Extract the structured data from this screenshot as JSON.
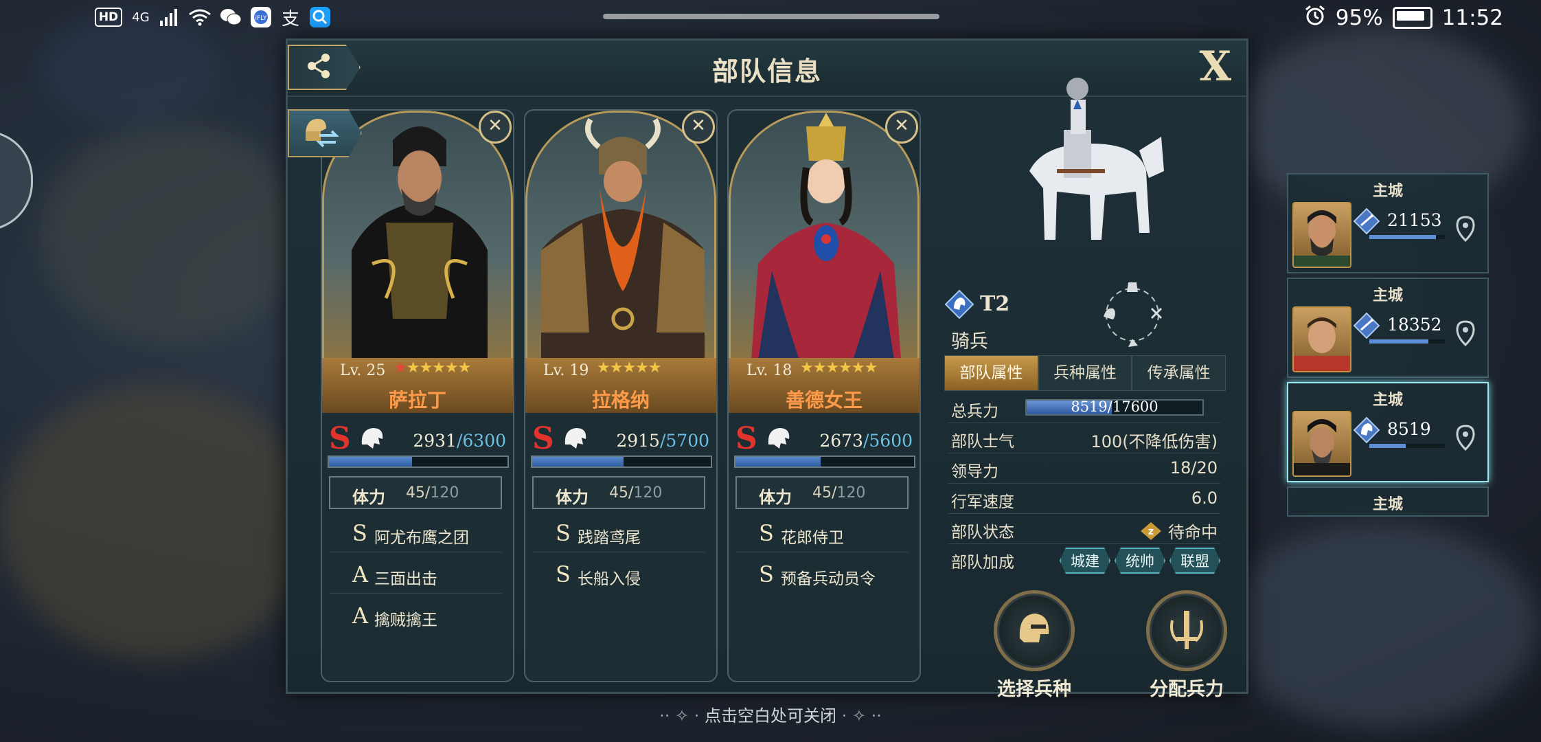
{
  "status_bar": {
    "left_icons": [
      "HD",
      "4G",
      "signal-icon",
      "wifi-icon",
      "wechat-icon",
      "ifly-icon",
      "alipay-icon",
      "search-app-icon"
    ],
    "alarm_icon": "alarm-icon",
    "battery_percent": "95%",
    "time": "11:52"
  },
  "panel": {
    "title": "部队信息",
    "close_label": "X",
    "share_icon": "share-icon",
    "swap_icon": "swap-commander-icon"
  },
  "commanders": [
    {
      "level": "Lv. 25",
      "stars": 6,
      "red_stars": 1,
      "name": "萨拉丁",
      "rank": "S",
      "troops": "2931",
      "troops_max": "/6300",
      "troop_fraction": 0.465,
      "stamina_label": "体力",
      "stamina_value": "45/",
      "stamina_max": "120",
      "skills": [
        {
          "rank": "S",
          "name": "阿尤布鹰之团"
        },
        {
          "rank": "A",
          "name": "三面出击"
        },
        {
          "rank": "A",
          "name": "擒贼擒王"
        }
      ]
    },
    {
      "level": "Lv. 19",
      "stars": 5,
      "red_stars": 0,
      "name": "拉格纳",
      "rank": "S",
      "troops": "2915",
      "troops_max": "/5700",
      "troop_fraction": 0.511,
      "stamina_label": "体力",
      "stamina_value": "45/",
      "stamina_max": "120",
      "skills": [
        {
          "rank": "S",
          "name": "践踏鸢尾"
        },
        {
          "rank": "S",
          "name": "长船入侵"
        }
      ]
    },
    {
      "level": "Lv. 18",
      "stars": 6,
      "red_stars": 0,
      "name": "善德女王",
      "rank": "S",
      "troops": "2673",
      "troops_max": "/5600",
      "troop_fraction": 0.477,
      "stamina_label": "体力",
      "stamina_value": "45/",
      "stamina_max": "120",
      "skills": [
        {
          "rank": "S",
          "name": "花郎侍卫"
        },
        {
          "rank": "S",
          "name": "预备兵动员令"
        }
      ]
    }
  ],
  "unit": {
    "tier": "T2",
    "type": "骑兵",
    "tabs": [
      "部队属性",
      "兵种属性",
      "传承属性"
    ],
    "active_tab": 0,
    "attributes": {
      "total_troops_label": "总兵力",
      "total_troops_value": "8519/17600",
      "total_troops_fraction": 0.484,
      "morale_label": "部队士气",
      "morale_value": "100(不降低伤害)",
      "leadership_label": "领导力",
      "leadership_value": "18/20",
      "speed_label": "行军速度",
      "speed_value": "6.0",
      "status_label": "部队状态",
      "status_value": "待命中",
      "bonus_label": "部队加成",
      "bonus_chips": [
        "城建",
        "统帅",
        "联盟"
      ]
    },
    "actions": {
      "select_unit": "选择兵种",
      "allocate_troops": "分配兵力"
    }
  },
  "hint": "点击空白处可关闭",
  "cities": [
    {
      "title": "主城",
      "count": "21153",
      "fraction": 0.88
    },
    {
      "title": "主城",
      "count": "18352",
      "fraction": 0.78
    },
    {
      "title": "主城",
      "count": "8519",
      "fraction": 0.48
    },
    {
      "title": "主城"
    }
  ]
}
